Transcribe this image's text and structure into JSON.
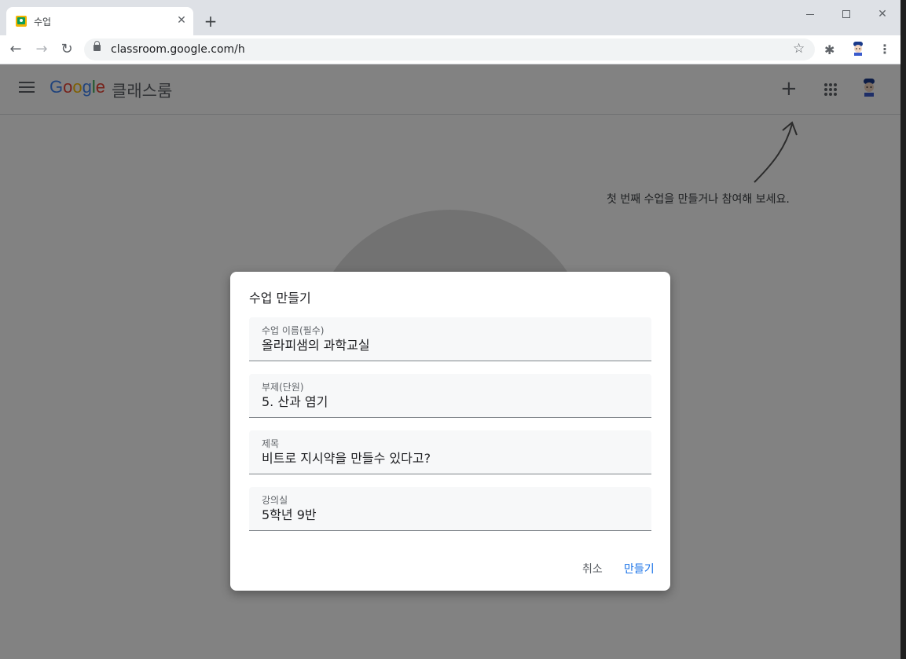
{
  "browser": {
    "tab_title": "수업",
    "url": "classroom.google.com/h"
  },
  "appbar": {
    "logo": [
      "G",
      "o",
      "o",
      "g",
      "l",
      "e"
    ],
    "product_name": "클래스룸"
  },
  "empty_state": {
    "hint": "첫 번째 수업을 만들거나 참여해 보세요."
  },
  "dialog": {
    "title": "수업 만들기",
    "fields": [
      {
        "label": "수업 이름(필수)",
        "value": "올라피샘의 과학교실"
      },
      {
        "label": "부제(단원)",
        "value": "5. 산과 염기"
      },
      {
        "label": "제목",
        "value": "비트로 지시약을 만들수 있다고?"
      },
      {
        "label": "강의실",
        "value": "5학년 9반"
      }
    ],
    "cancel_label": "취소",
    "create_label": "만들기"
  },
  "colors": {
    "accent": "#1a73e8",
    "google_blue": "#4285f4",
    "google_red": "#ea4335",
    "google_yellow": "#fbbc05",
    "google_green": "#34a853"
  },
  "icons": [
    "tab-favicon-icon",
    "close-icon",
    "plus-icon",
    "back-icon",
    "forward-icon",
    "reload-icon",
    "lock-icon",
    "star-icon",
    "puzzle-icon",
    "menu-icon",
    "apps-grid-icon",
    "more-vert-icon"
  ]
}
